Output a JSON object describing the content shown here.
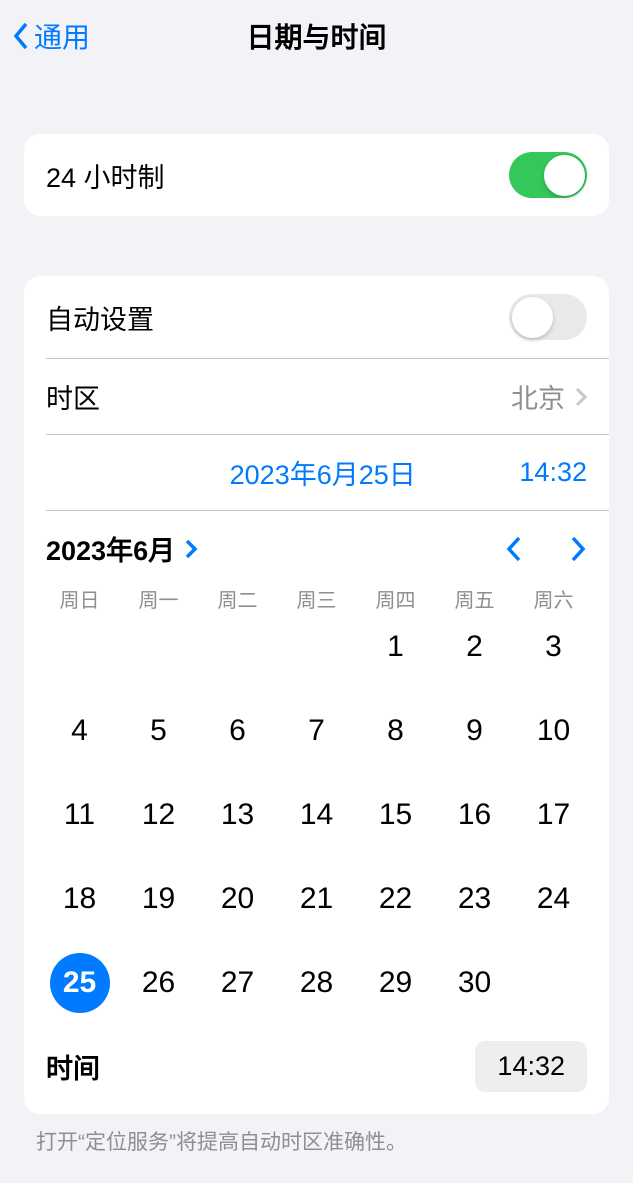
{
  "header": {
    "back_label": "通用",
    "title": "日期与时间"
  },
  "settings": {
    "twenty_four_hour_label": "24 小时制",
    "twenty_four_hour_on": true,
    "auto_set_label": "自动设置",
    "auto_set_on": false,
    "timezone_label": "时区",
    "timezone_value": "北京"
  },
  "summary": {
    "date": "2023年6月25日",
    "time": "14:32"
  },
  "calendar": {
    "month_label": "2023年6月",
    "weekdays": [
      "周日",
      "周一",
      "周二",
      "周三",
      "周四",
      "周五",
      "周六"
    ],
    "leading_empty": 4,
    "days_in_month": 30,
    "selected_day": 25
  },
  "time_row": {
    "label": "时间",
    "value": "14:32"
  },
  "footer_note": "打开“定位服务”将提高自动时区准确性。"
}
